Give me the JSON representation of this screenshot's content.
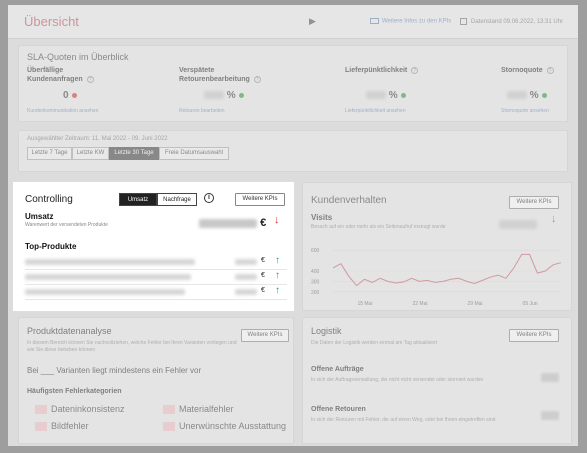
{
  "header": {
    "title": "Übersicht",
    "link": "Weitere Infos zu den KPIs",
    "date": "Datenstand 09.06.2022, 13:31 Uhr"
  },
  "sla": {
    "title": "SLA-Quoten im Überblick",
    "kpis": [
      {
        "label1": "Überfällige",
        "label2": "Kundenanfragen",
        "value": "0",
        "unit": "",
        "status": "red",
        "link": "Kundenkommunikation ansehen"
      },
      {
        "label1": "Verspätete",
        "label2": "Retourenbearbeitung",
        "value": "",
        "unit": "%",
        "status": "green",
        "link": "Retouren bearbeiten"
      },
      {
        "label1": "Lieferpünktlichkeit",
        "label2": "",
        "value": "",
        "unit": "%",
        "status": "green",
        "link": "Lieferpünktlichkeit ansehen"
      },
      {
        "label1": "Stornoquote",
        "label2": "",
        "value": "",
        "unit": "%",
        "status": "green",
        "link": "Stornoquote ansehen"
      }
    ]
  },
  "range": {
    "label": "Ausgewählter Zeitraum: 11. Mai 2022 - 09. Juni 2022",
    "options": [
      "Letzte 7 Tage",
      "Letzte KW",
      "Letzte 30 Tage",
      "Freie Datumsauswahl"
    ],
    "active": 2
  },
  "controlling": {
    "title": "Controlling",
    "toggle_a": "Umsatz",
    "toggle_b": "Nachfrage",
    "more_kpis": "Weitere KPIs",
    "umsatz_label": "Umsatz",
    "umsatz_sub": "Warenwert der versendeten Produkte",
    "umsatz_value": "56.986,75",
    "currency": "€",
    "top_title": "Top-Produkte",
    "product_rows": 3
  },
  "kundenverhalten": {
    "title": "Kundenverhalten",
    "more_kpis": "Weitere KPIs",
    "visits_label": "Visits",
    "visits_sub": "Besuch auf ein oder mehr als ein Seitenaufruf erzeugt wurde",
    "visits_value": "11.683"
  },
  "chart_data": {
    "type": "line",
    "title": "",
    "xlabel": "",
    "ylabel": "",
    "y_tick_labels": [
      "600",
      "400",
      "300",
      "200"
    ],
    "x_tick_labels": [
      "15 Mai",
      "22 Mai",
      "29 Mai",
      "05 Jun"
    ],
    "ylim": [
      150,
      650
    ],
    "x": [
      "11 Mai",
      "12 Mai",
      "13 Mai",
      "14 Mai",
      "15 Mai",
      "16 Mai",
      "17 Mai",
      "18 Mai",
      "19 Mai",
      "20 Mai",
      "21 Mai",
      "22 Mai",
      "23 Mai",
      "24 Mai",
      "25 Mai",
      "26 Mai",
      "27 Mai",
      "28 Mai",
      "29 Mai",
      "30 Mai",
      "31 Mai",
      "01 Jun",
      "02 Jun",
      "03 Jun",
      "04 Jun",
      "05 Jun",
      "06 Jun",
      "07 Jun",
      "08 Jun",
      "09 Jun"
    ],
    "series": [
      {
        "name": "",
        "color": "#c9636f",
        "values": [
          430,
          470,
          350,
          260,
          320,
          290,
          330,
          300,
          285,
          295,
          330,
          300,
          310,
          290,
          300,
          320,
          330,
          300,
          280,
          310,
          340,
          360,
          330,
          430,
          560,
          560,
          380,
          400,
          460,
          480
        ]
      }
    ]
  },
  "produktdaten": {
    "title": "Produktdatenanalyse",
    "sub": "In diesem Bereich können Sie nachvollziehen, welche Fehler bei Ihren Varianten vorliegen und wie Sie diese beheben können",
    "bei_text": "Bei ___ Varianten liegt mindestens ein Fehler vor",
    "more_kpis": "Weitere KPIs",
    "categories_title": "Häufigsten Fehlerkategorien",
    "categories": [
      "Dateninkonsistenz",
      "Materialfehler",
      "Bildfehler",
      "Unerwünschte Ausstattung"
    ]
  },
  "logistik": {
    "title": "Logistik",
    "sub": "Die Daten der Logistik werden einmal am Tag aktualisiert",
    "more_kpis": "Weitere KPIs",
    "items": [
      {
        "title": "Offene Aufträge",
        "sub": "In sich der Auftragsverwaltung, die nicht nicht versendet oder storniert wurden"
      },
      {
        "title": "Offene Retouren",
        "sub": "In sich der Retouren mit Fehler, die auf einen Weg, oder bei Ihnen eingetroffen sind"
      }
    ]
  },
  "colors": {
    "accent": "#c05a66",
    "down": "#d2373c",
    "up": "#2e9e45",
    "dark": "#222222"
  }
}
